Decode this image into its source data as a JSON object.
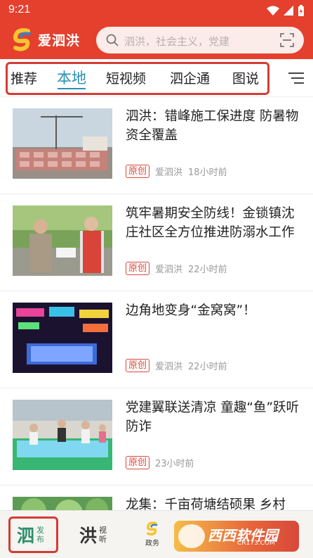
{
  "status_bar": {
    "time": "9:21"
  },
  "header": {
    "app_name": "爱泗洪",
    "search_placeholder": "泗洪，社会主义，党建"
  },
  "tabs": [
    {
      "label": "推荐",
      "active": false
    },
    {
      "label": "本地",
      "active": true
    },
    {
      "label": "短视频",
      "active": false
    },
    {
      "label": "泗企通",
      "active": false
    },
    {
      "label": "图说",
      "active": false
    }
  ],
  "news": [
    {
      "title": "泗洪：错峰施工保进度 防暑物资全覆盖",
      "badge": "原创",
      "source": "爱泗洪",
      "time": "18小时前",
      "thumb": "construction-site"
    },
    {
      "title": "筑牢暑期安全防线！金锁镇沈庄社区全方位推进防溺水工作",
      "badge": "原创",
      "source": "爱泗洪",
      "time": "22小时前",
      "thumb": "outreach-people"
    },
    {
      "title": "边角地变身“金窝窝”！",
      "badge": "原创",
      "source": "爱泗洪",
      "time": "22小时前",
      "thumb": "night-market"
    },
    {
      "title": "党建翼联送清凉 童趣“鱼”跃听防诈",
      "badge": "原创",
      "source": "",
      "time": "23小时前",
      "thumb": "kids-pool"
    },
    {
      "title": "龙集：千亩荷塘结硕果 乡村",
      "badge": "",
      "source": "",
      "time": "",
      "thumb": "lotus-pond"
    }
  ],
  "bottom_nav": [
    {
      "big": "泗",
      "small_top": "发",
      "small_bottom": "布",
      "active": true
    },
    {
      "big": "洪",
      "small_top": "视",
      "small_bottom": "听",
      "active": false
    },
    {
      "label": "政务",
      "icon": "gov-logo-icon"
    }
  ],
  "watermark": {
    "text": "西西软件园",
    "sub": "CR173.COM"
  },
  "colors": {
    "brand_red": "#e4402d",
    "accent_blue": "#2b8fb4",
    "highlight_red": "#d43c35"
  }
}
